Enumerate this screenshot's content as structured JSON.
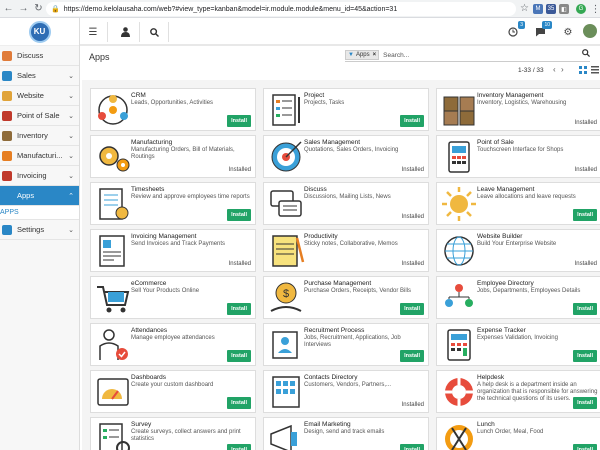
{
  "browser": {
    "url": "https://demo.kelolausaha.com/web?#view_type=kanban&model=ir.module.module&menu_id=45&action=31",
    "ext_badges": [
      "35",
      "G"
    ]
  },
  "logo": {
    "letters": "KU"
  },
  "sidebar": {
    "items": [
      {
        "label": "Discuss",
        "color": "#e07b39",
        "chevron": false,
        "active": false
      },
      {
        "label": "Sales",
        "color": "#2a87c6",
        "chevron": true,
        "active": false
      },
      {
        "label": "Website",
        "color": "#e0a339",
        "chevron": true,
        "active": false
      },
      {
        "label": "Point of Sale",
        "color": "#c0392b",
        "chevron": true,
        "active": false
      },
      {
        "label": "Inventory",
        "color": "#8e6b3a",
        "chevron": true,
        "active": false
      },
      {
        "label": "Manufacturi...",
        "color": "#e67e22",
        "chevron": true,
        "active": false
      },
      {
        "label": "Invoicing",
        "color": "#c0392b",
        "chevron": true,
        "active": false
      },
      {
        "label": "Apps",
        "color": "#2a87c6",
        "chevron": true,
        "active": true
      }
    ],
    "submenu_label": "APPS",
    "settings_label": "Settings"
  },
  "topbar": {
    "activity_badge": "3",
    "messages_badge": "10"
  },
  "control_panel": {
    "title": "Apps",
    "facet_label": "Apps",
    "search_placeholder": "Search...",
    "pager": "1-33 / 33"
  },
  "apps": [
    {
      "name": "CRM",
      "desc": "Leads, Opportunities, Activities",
      "status": "Install",
      "icon": "crm-icon"
    },
    {
      "name": "Project",
      "desc": "Projects, Tasks",
      "status": "Install",
      "icon": "project-icon"
    },
    {
      "name": "Inventory Management",
      "desc": "Inventory, Logistics, Warehousing",
      "status": "Installed",
      "icon": "inventory-icon"
    },
    {
      "name": "Manufacturing",
      "desc": "Manufacturing Orders, Bill of Materials, Routings",
      "status": "Installed",
      "icon": "manufacturing-icon"
    },
    {
      "name": "Sales Management",
      "desc": "Quotations, Sales Orders, Invoicing",
      "status": "Installed",
      "icon": "sales-icon"
    },
    {
      "name": "Point of Sale",
      "desc": "Touchscreen Interface for Shops",
      "status": "Installed",
      "icon": "pos-icon"
    },
    {
      "name": "Timesheets",
      "desc": "Review and approve employees time reports",
      "status": "Install",
      "icon": "timesheets-icon"
    },
    {
      "name": "Discuss",
      "desc": "Discussions, Mailing Lists, News",
      "status": "Installed",
      "icon": "discuss-icon"
    },
    {
      "name": "Leave Management",
      "desc": "Leave allocations and leave requests",
      "status": "Install",
      "icon": "leave-icon"
    },
    {
      "name": "Invoicing Management",
      "desc": "Send Invoices and Track Payments",
      "status": "Installed",
      "icon": "invoicing-icon"
    },
    {
      "name": "Productivity",
      "desc": "Sticky notes, Collaborative, Memos",
      "status": "Installed",
      "icon": "productivity-icon"
    },
    {
      "name": "Website Builder",
      "desc": "Build Your Enterprise Website",
      "status": "Installed",
      "icon": "website-icon"
    },
    {
      "name": "eCommerce",
      "desc": "Sell Your Products Online",
      "status": "Install",
      "icon": "ecommerce-icon"
    },
    {
      "name": "Purchase Management",
      "desc": "Purchase Orders, Receipts, Vendor Bills",
      "status": "Install",
      "icon": "purchase-icon"
    },
    {
      "name": "Employee Directory",
      "desc": "Jobs, Departments, Employees Details",
      "status": "Install",
      "icon": "employees-icon"
    },
    {
      "name": "Attendances",
      "desc": "Manage employee attendances",
      "status": "Install",
      "icon": "attendances-icon"
    },
    {
      "name": "Recruitment Process",
      "desc": "Jobs, Recruitment, Applications, Job Interviews",
      "status": "Install",
      "icon": "recruitment-icon"
    },
    {
      "name": "Expense Tracker",
      "desc": "Expenses Validation, Invoicing",
      "status": "Install",
      "icon": "expense-icon"
    },
    {
      "name": "Dashboards",
      "desc": "Create your custom dashboard",
      "status": "Install",
      "icon": "dashboards-icon"
    },
    {
      "name": "Contacts Directory",
      "desc": "Customers, Vendors, Partners,...",
      "status": "Installed",
      "icon": "contacts-icon"
    },
    {
      "name": "Helpdesk",
      "desc": "A help desk is a department inside an organization that is responsible for answering the technical questions of its users.",
      "status": "Install",
      "icon": "helpdesk-icon"
    },
    {
      "name": "Survey",
      "desc": "Create surveys, collect answers and print statistics",
      "status": "Install",
      "icon": "survey-icon"
    },
    {
      "name": "Email Marketing",
      "desc": "Design, send and track emails",
      "status": "Install",
      "icon": "email-marketing-icon"
    },
    {
      "name": "Lunch",
      "desc": "Lunch Order, Meal, Food",
      "status": "Install",
      "icon": "lunch-icon"
    }
  ]
}
